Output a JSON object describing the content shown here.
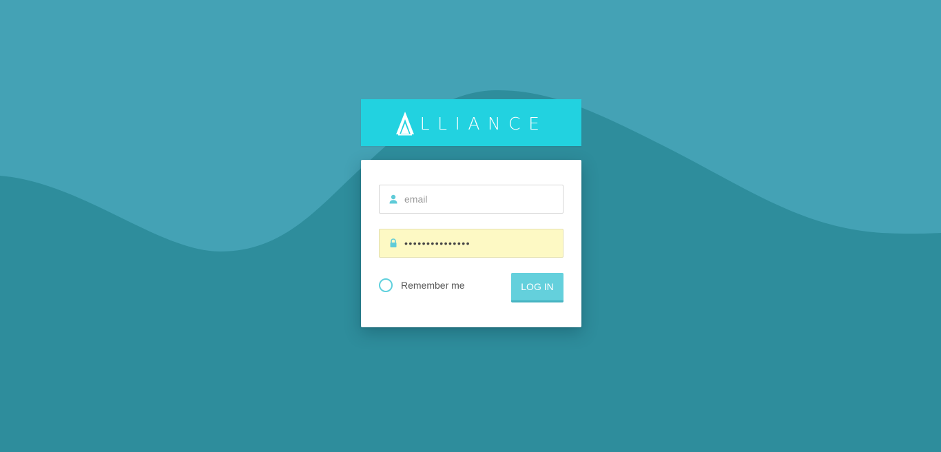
{
  "brand": {
    "name": "LLIANCE",
    "logo_icon": "alliance-a-icon",
    "bar_color": "#22d2e0"
  },
  "colors": {
    "background_light": "#44a2b5",
    "background_dark": "#2e8d9c",
    "accent": "#64d0dc",
    "autofill": "#fdf9c4"
  },
  "login_form": {
    "email": {
      "icon": "user-icon",
      "placeholder": "email",
      "value": ""
    },
    "password": {
      "icon": "lock-icon",
      "value": "•••••••••••••••"
    },
    "remember_label": "Remember me",
    "remember_checked": false,
    "submit_label": "LOG IN"
  }
}
